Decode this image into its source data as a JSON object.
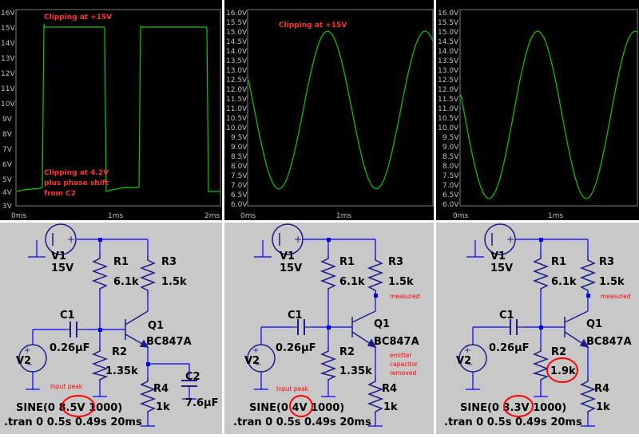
{
  "colors": {
    "plot_bg": "#000000",
    "plot_axis": "#808080",
    "trace": "#00d000",
    "annotation": "#ff3333",
    "schematic_bg": "#c8c8c8",
    "wire": "#0000ff",
    "component": "#1c1c8c",
    "node": "#0000ff",
    "text": "#000000",
    "circle": "#ff0000"
  },
  "plots": [
    {
      "yticks": [
        "16V",
        "15V",
        "14V",
        "13V",
        "12V",
        "11V",
        "10V",
        "9V",
        "8V",
        "7V",
        "6V",
        "5V",
        "4V",
        "3V"
      ],
      "xticks": [
        "0ms",
        "1ms",
        "2ms"
      ],
      "notes": [
        "Clipping at +15V",
        "Clipping at 4.2V",
        "plus phase shift",
        "from C2"
      ]
    },
    {
      "yticks": [
        "16.0V",
        "15.5V",
        "15.0V",
        "14.5V",
        "14.0V",
        "13.5V",
        "13.0V",
        "12.5V",
        "12.0V",
        "11.5V",
        "11.0V",
        "10.5V",
        "10.0V",
        "9.5V",
        "9.0V",
        "8.5V",
        "8.0V",
        "7.5V",
        "7.0V",
        "6.5V",
        "6.0V"
      ],
      "xticks": [
        "0ms",
        "1ms"
      ],
      "notes": [
        "Clipping at +15V"
      ]
    },
    {
      "yticks": [
        "16.0V",
        "15.5V",
        "15.0V",
        "14.5V",
        "14.0V",
        "13.5V",
        "13.0V",
        "12.5V",
        "12.0V",
        "11.5V",
        "11.0V",
        "10.5V",
        "10.0V",
        "9.5V",
        "9.0V",
        "8.5V",
        "8.0V",
        "7.5V",
        "7.0V",
        "6.5V",
        "6.0V"
      ],
      "xticks": [
        "0ms",
        "1ms"
      ],
      "notes": []
    }
  ],
  "schematics": [
    {
      "v1_name": "V1",
      "v1_value": "15V",
      "r1_name": "R1",
      "r1_value": "6.1k",
      "r3_name": "R3",
      "r3_value": "1.5k",
      "c1_name": "C1",
      "c1_value": "0.26µF",
      "q1_name": "Q1",
      "q1_value": "BC847A",
      "v2_name": "V2",
      "r2_name": "R2",
      "r2_value": "1.35k",
      "r4_name": "R4",
      "r4_value": "1k",
      "c2_name": "C2",
      "c2_value": "7.6µF",
      "note_input": "Input peak",
      "sine_pre": "SINE(0",
      "sine_amp": "8.5V",
      "sine_post": "1000)",
      "tran": ".tran 0 0.5s 0.49s 20ms"
    },
    {
      "v1_name": "V1",
      "v1_value": "15V",
      "r1_name": "R1",
      "r1_value": "6.1k",
      "r3_name": "R3",
      "r3_value": "1.5k",
      "c1_name": "C1",
      "c1_value": "0.26µF",
      "q1_name": "Q1",
      "q1_value": "BC847A",
      "v2_name": "V2",
      "r2_name": "R2",
      "r2_value": "1.35k",
      "r4_name": "R4",
      "r4_value": "1k",
      "note_input": "Input peak",
      "note_measured": "measured",
      "note_emitter": [
        "emitter",
        "capacitor",
        "removed"
      ],
      "sine_pre": "SINE(0",
      "sine_amp": "4V",
      "sine_post": "1000)",
      "tran": ".tran 0 0.5s 0.49s 20ms"
    },
    {
      "v1_name": "V1",
      "v1_value": "15V",
      "r1_name": "R1",
      "r1_value": "6.1k",
      "r3_name": "R3",
      "r3_value": "1.5k",
      "c1_name": "C1",
      "c1_value": "0.26µF",
      "q1_name": "Q1",
      "q1_value": "BC847A",
      "v2_name": "V2",
      "r2_name": "R2",
      "r2_value": "1.9k",
      "r4_name": "R4",
      "r4_value": "1k",
      "note_measured": "measured",
      "sine_pre": "SINE(0",
      "sine_amp": "3.3V",
      "sine_post": "1000)",
      "tran": ".tran 0 0.5s 0.49s 20ms"
    }
  ]
}
